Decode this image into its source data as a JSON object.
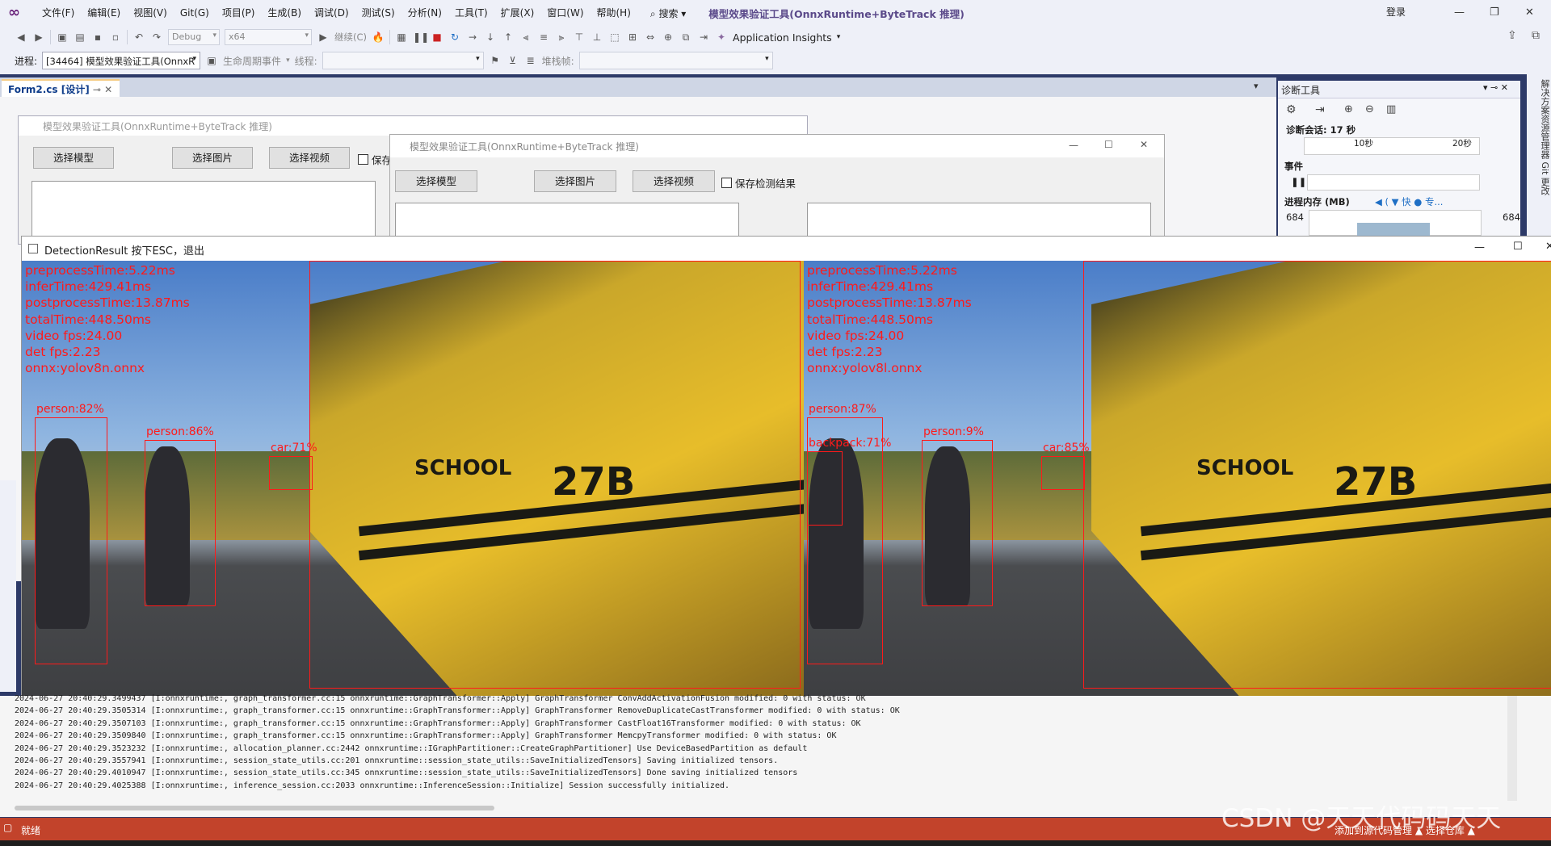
{
  "menubar": {
    "items": [
      "文件(F)",
      "编辑(E)",
      "视图(V)",
      "Git(G)",
      "项目(P)",
      "生成(B)",
      "调试(D)",
      "测试(S)",
      "分析(N)",
      "工具(T)",
      "扩展(X)",
      "窗口(W)",
      "帮助(H)"
    ],
    "search": "搜索",
    "title": "模型效果验证工具(OnnxRuntime+ByteTrack 推理)",
    "login": "登录"
  },
  "toolbar": {
    "config": "Debug",
    "platform": "x64",
    "continue": "继续(C)",
    "insights": "Application Insights"
  },
  "procbar": {
    "process_label": "进程:",
    "process_value": "[34464] 模型效果验证工具(OnnxR",
    "lifecycle": "生命周期事件",
    "thread_label": "线程:",
    "stack_label": "堆栈帧:"
  },
  "doctab": {
    "label": "Form2.cs [设计]"
  },
  "diagnostics": {
    "title": "诊断工具",
    "session": "诊断会话: 17 秒",
    "tick1": "10秒",
    "tick2": "20秒",
    "events": "事件",
    "memory": "进程内存 (MB)",
    "mem_left": "684",
    "mem_right": "684",
    "legend": "◀ ( ▼ 快 ● 专..."
  },
  "rightstrip": {
    "text": "解决方案资源管理器   Git 更改"
  },
  "form1": {
    "title": "模型效果验证工具(OnnxRuntime+ByteTrack 推理)",
    "btn_model": "选择模型",
    "btn_image": "选择图片",
    "btn_video": "选择视频",
    "chk_save": "保存"
  },
  "form2": {
    "title": "模型效果验证工具(OnnxRuntime+ByteTrack 推理)",
    "btn_model": "选择模型",
    "btn_image": "选择图片",
    "btn_video": "选择视频",
    "chk_save": "保存检测结果"
  },
  "detection": {
    "window_title": "DetectionResult 按下ESC，退出",
    "left": {
      "stats": "preprocessTime:5.22ms\ninferTime:429.41ms\npostprocessTime:13.87ms\ntotalTime:448.50ms\nvideo fps:24.00\ndet fps:2.23\nonnx:yolov8n.onnx",
      "labels": [
        "person:82%",
        "person:86%",
        "car:71%"
      ]
    },
    "right": {
      "stats": "preprocessTime:5.22ms\ninferTime:429.41ms\npostprocessTime:13.87ms\ntotalTime:448.50ms\nvideo fps:24.00\ndet fps:2.23\nonnx:yolov8l.onnx",
      "labels": [
        "person:87%",
        "backpack:71%",
        "person:9%",
        "car:85%"
      ]
    },
    "bus_text": {
      "school": "SCHOOL",
      "number": "27B"
    }
  },
  "output_log": [
    "2024-06-27 20:40:29.3499437 [I:onnxruntime:, graph_transformer.cc:15 onnxruntime::GraphTransformer::Apply] GraphTransformer ConvAddActivationFusion modified: 0 with status: OK",
    "2024-06-27 20:40:29.3505314 [I:onnxruntime:, graph_transformer.cc:15 onnxruntime::GraphTransformer::Apply] GraphTransformer RemoveDuplicateCastTransformer modified: 0 with status: OK",
    "2024-06-27 20:40:29.3507103 [I:onnxruntime:, graph_transformer.cc:15 onnxruntime::GraphTransformer::Apply] GraphTransformer CastFloat16Transformer modified: 0 with status: OK",
    "2024-06-27 20:40:29.3509840 [I:onnxruntime:, graph_transformer.cc:15 onnxruntime::GraphTransformer::Apply] GraphTransformer MemcpyTransformer modified: 0 with status: OK",
    "2024-06-27 20:40:29.3523232 [I:onnxruntime:, allocation_planner.cc:2442 onnxruntime::IGraphPartitioner::CreateGraphPartitioner] Use DeviceBasedPartition as default",
    "2024-06-27 20:40:29.3557941 [I:onnxruntime:, session_state_utils.cc:201 onnxruntime::session_state_utils::SaveInitializedTensors] Saving initialized tensors.",
    "2024-06-27 20:40:29.4010947 [I:onnxruntime:, session_state_utils.cc:345 onnxruntime::session_state_utils::SaveInitializedTensors] Done saving initialized tensors",
    "2024-06-27 20:40:29.4025388 [I:onnxruntime:, inference_session.cc:2033 onnxruntime::InferenceSession::Initialize] Session successfully initialized."
  ],
  "statusbar": {
    "text": "就绪",
    "right": "添加到源代码管理 ▲   选择仓库 ▲"
  },
  "watermark": "CSDN @天天代码码天天"
}
